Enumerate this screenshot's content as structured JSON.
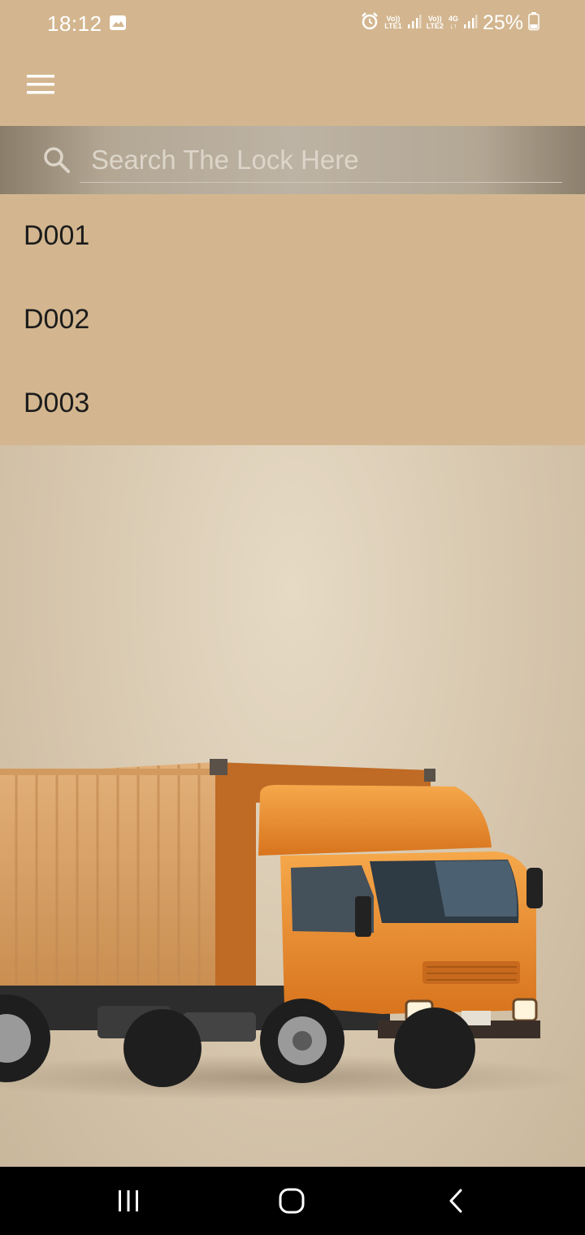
{
  "status_bar": {
    "time": "18:12",
    "battery_percent": "25%",
    "sim1_label_top": "Vo))",
    "sim1_label_bottom": "LTE1",
    "sim2_label_top": "Vo))",
    "sim2_label_bottom": "LTE2",
    "network_type": "4G",
    "icons": [
      "gallery-icon",
      "alarm-icon",
      "signal-icon",
      "signal-icon",
      "battery-icon"
    ]
  },
  "app_bar": {
    "menu_icon": "hamburger-menu-icon"
  },
  "search": {
    "placeholder": "Search The Lock Here",
    "value": "",
    "icon": "search-icon"
  },
  "locks": [
    {
      "label": "D001"
    },
    {
      "label": "D002"
    },
    {
      "label": "D003"
    }
  ],
  "nav_bar": {
    "icons": [
      "recent-apps-icon",
      "home-icon",
      "back-icon"
    ]
  },
  "colors": {
    "primary": "#d3b68f",
    "truck_cab": "#e98a2a",
    "nav_bar": "#000000"
  }
}
